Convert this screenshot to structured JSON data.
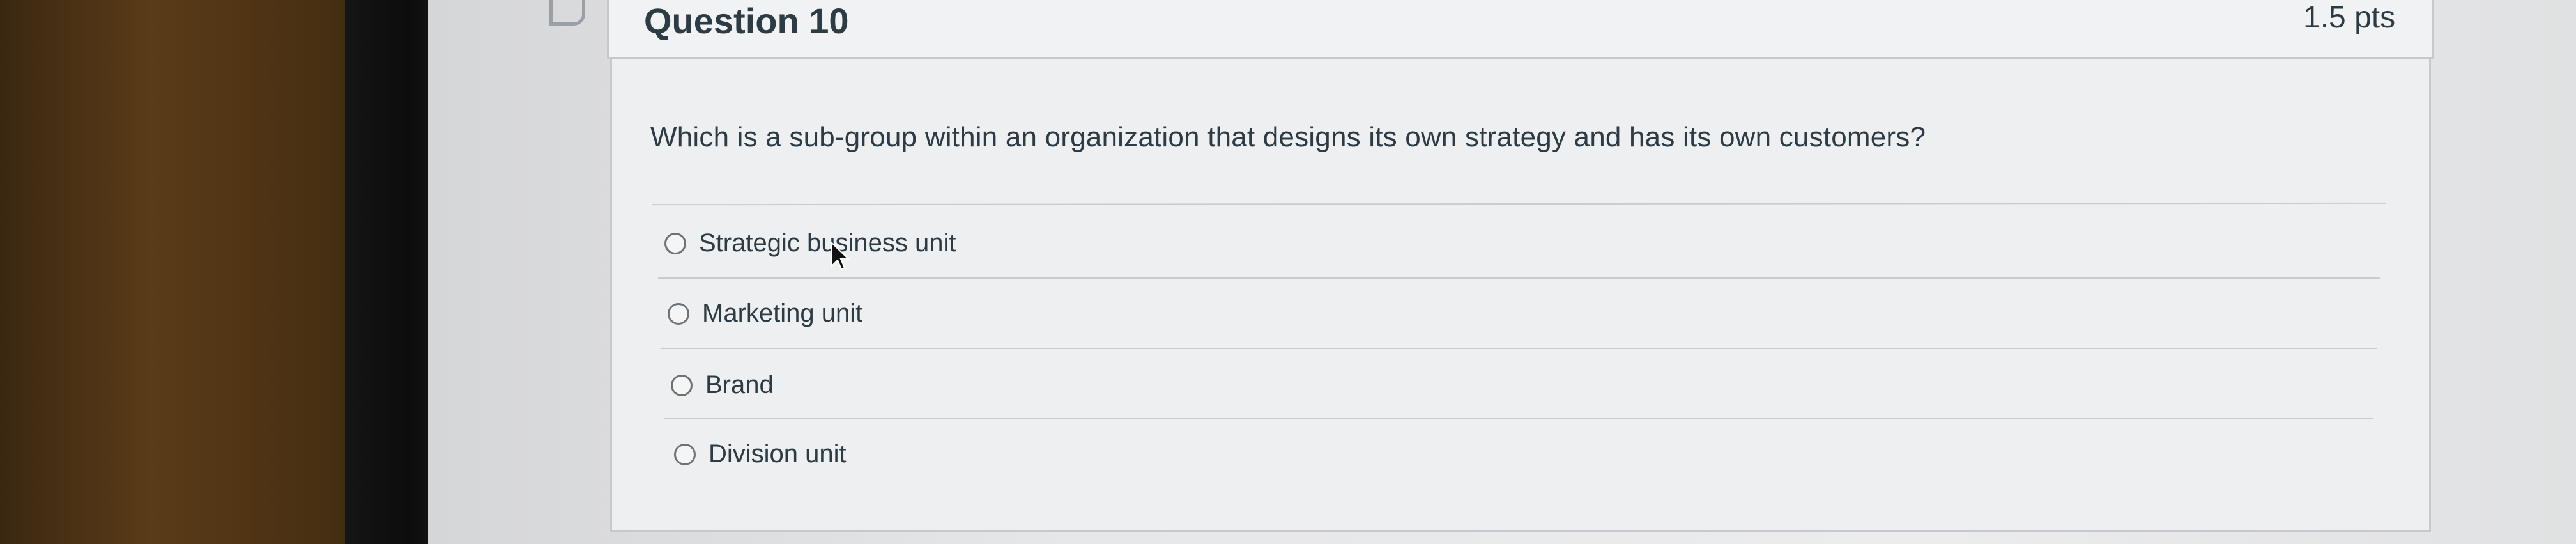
{
  "question": {
    "title": "Question 10",
    "points": "1.5 pts",
    "text": "Which is a sub-group within an organization that designs its own strategy and has its own customers?",
    "answers": [
      {
        "label": "Strategic business unit"
      },
      {
        "label": "Marketing unit"
      },
      {
        "label": "Brand"
      },
      {
        "label": "Division unit"
      }
    ]
  },
  "icons": {
    "bookmark": "bookmark-icon",
    "cursor": "mouse-pointer-icon"
  }
}
